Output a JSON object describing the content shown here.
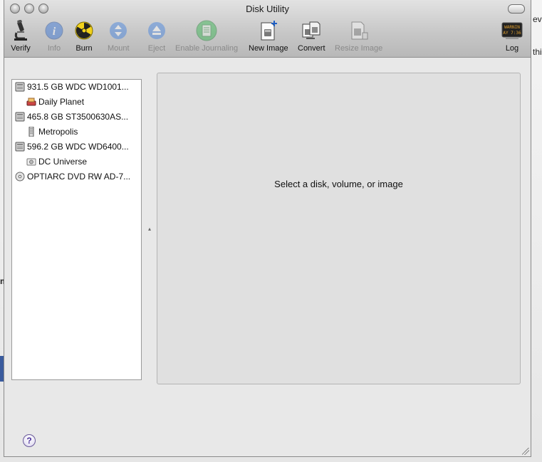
{
  "window": {
    "title": "Disk Utility"
  },
  "toolbar": {
    "verify": "Verify",
    "info": "Info",
    "burn": "Burn",
    "mount": "Mount",
    "eject": "Eject",
    "enable_journaling": "Enable Journaling",
    "new_image": "New Image",
    "convert": "Convert",
    "resize_image": "Resize Image",
    "log": "Log",
    "log_icon_text": [
      "WARNIN",
      "AY 7:36"
    ]
  },
  "sidebar": {
    "items": [
      {
        "label": "931.5 GB WDC WD1001...",
        "icon": "hard-drive-icon",
        "level": 0
      },
      {
        "label": "Daily Planet",
        "icon": "volume-icon",
        "level": 1
      },
      {
        "label": "465.8 GB ST3500630AS...",
        "icon": "hard-drive-icon",
        "level": 0
      },
      {
        "label": "Metropolis",
        "icon": "volume-icon",
        "level": 1
      },
      {
        "label": "596.2 GB WDC WD6400...",
        "icon": "hard-drive-icon",
        "level": 0
      },
      {
        "label": "DC Universe",
        "icon": "volume-icon",
        "level": 1
      },
      {
        "label": "OPTIARC DVD RW AD-7...",
        "icon": "optical-drive-icon",
        "level": 0
      }
    ]
  },
  "detail": {
    "message": "Select a disk, volume, or image"
  },
  "background": {
    "fragment_1": "eve",
    "fragment_2": "thi",
    "fragment_3": "m"
  },
  "colors": {
    "accent_blue": "#3a5b9e",
    "window_bg": "#e8e8e8"
  }
}
